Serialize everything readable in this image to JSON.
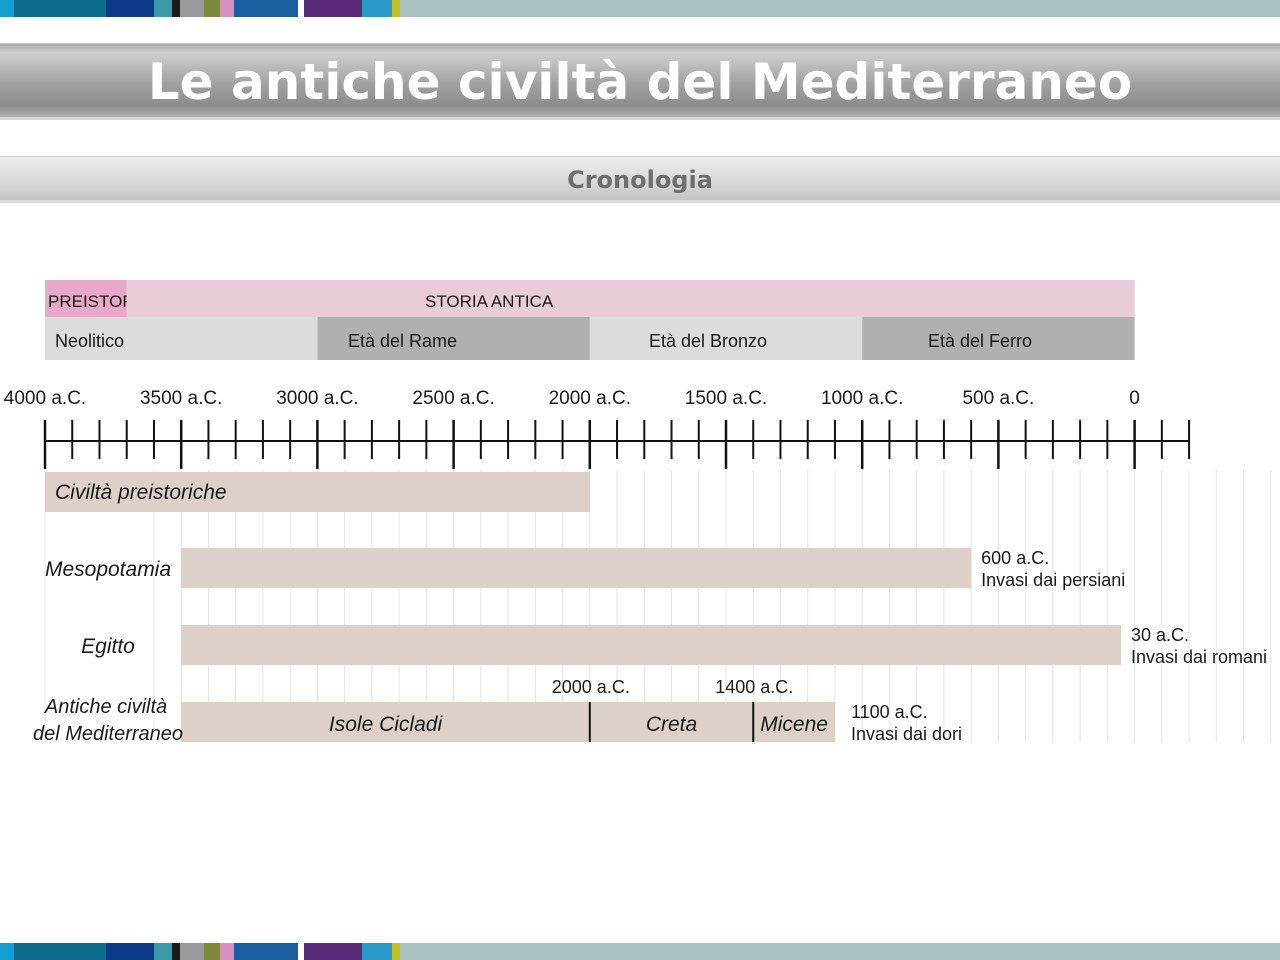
{
  "header": {
    "title": "Le antiche civiltà del Mediterraneo",
    "subtitle": "Cronologia"
  },
  "decor": {
    "stripe_colors": [
      "#13a0d0",
      "#0d6b8b",
      "#0e3a8a",
      "#3a9aa8",
      "#1a1a1a",
      "#9a9a9a",
      "#7a8a3a",
      "#d890c0",
      "#1a5fa0",
      "#5a2a7a",
      "#2a9ac8",
      "#c8c020",
      "#a8c0c0"
    ]
  },
  "timeline": {
    "periods": [
      {
        "label": "PREISTORIA",
        "start": -4000,
        "end": -3700,
        "color": "#e8a8c8"
      },
      {
        "label": "STORIA ANTICA",
        "start": -3700,
        "end": 0,
        "color": "#e8ccd8"
      }
    ],
    "ages": [
      {
        "label": "Neolitico",
        "start": -4000,
        "end": -3000,
        "color": "#dcdcdc"
      },
      {
        "label": "Età del Rame",
        "start": -3000,
        "end": -2000,
        "color": "#b0b0b0"
      },
      {
        "label": "Età del Bronzo",
        "start": -2000,
        "end": -1000,
        "color": "#dcdcdc"
      },
      {
        "label": "Età del Ferro",
        "start": -1000,
        "end": 0,
        "color": "#b0b0b0"
      }
    ],
    "axis": {
      "min": -4000,
      "max": 200,
      "minor_step": 100,
      "major_step": 500,
      "tick_labels": [
        {
          "value": -4000,
          "label": "4000 a.C."
        },
        {
          "value": -3500,
          "label": "3500 a.C."
        },
        {
          "value": -3000,
          "label": "3000 a.C."
        },
        {
          "value": -2500,
          "label": "2500 a.C."
        },
        {
          "value": -2000,
          "label": "2000 a.C."
        },
        {
          "value": -1500,
          "label": "1500 a.C."
        },
        {
          "value": -1000,
          "label": "1000 a.C."
        },
        {
          "value": -500,
          "label": "500 a.C."
        },
        {
          "value": 0,
          "label": "0"
        }
      ]
    },
    "rows": [
      {
        "label": [
          "Civiltà preistoriche"
        ],
        "label_inside": true,
        "bars": [
          {
            "start": -4000,
            "end": -2000
          }
        ],
        "end_note": []
      },
      {
        "label": [
          "Mesopotamia"
        ],
        "label_inside": false,
        "bars": [
          {
            "start": -3500,
            "end": -600
          }
        ],
        "end_note": [
          "600 a.C.",
          "Invasi dai persiani"
        ]
      },
      {
        "label": [
          "Egitto"
        ],
        "label_inside": false,
        "bars": [
          {
            "start": -3500,
            "end": -50
          }
        ],
        "end_note": [
          "30 a.C.",
          "Invasi dai romani"
        ]
      },
      {
        "label": [
          "Antiche civiltà",
          "del Mediterraneo"
        ],
        "label_inside": false,
        "bars": [
          {
            "start": -3500,
            "end": -2000,
            "label": "Isole Cicladi"
          },
          {
            "start": -2000,
            "end": -1400,
            "label": "Creta"
          },
          {
            "start": -1400,
            "end": -1100,
            "label": "Micene"
          }
        ],
        "dividers": [
          {
            "value": -2000,
            "label": "2000 a.C."
          },
          {
            "value": -1400,
            "label": "1400 a.C."
          }
        ],
        "end_note": [
          "1100 a.C.",
          "Invasi dai dori"
        ]
      }
    ],
    "bar_color": "#ddd0c8",
    "grid_color": "#e4e4e4"
  }
}
